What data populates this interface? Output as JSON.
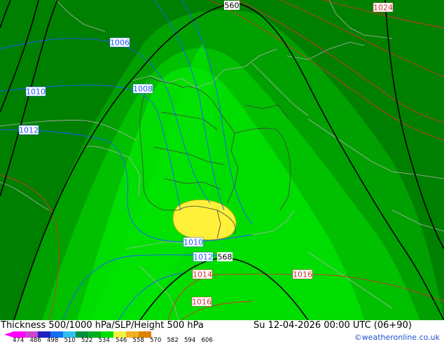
{
  "map": {
    "title": "Thickness 500/1000 hPa/SLP/Height 500 hPa",
    "datetime": "Su 12-04-2026 00:00 UTC (06+90)",
    "credit": "©weatheronline.co.uk",
    "colors": {
      "bg_dark": "#008000",
      "band1": "#00a000",
      "band2": "#00c000",
      "band3": "#00dd00",
      "warm": "#fff03a",
      "slp_blue": "#1e5aff",
      "slp_red": "#d23232",
      "height": "#000000",
      "border": "#b0b0b0"
    },
    "labels": {
      "slp_1006": "1006",
      "slp_1008": "1008",
      "slp_1010_w": "1010",
      "slp_1012_w": "1012",
      "slp_1010_s": "1010",
      "slp_1012_s": "1012",
      "slp_1014": "1014",
      "slp_1016_e": "1016",
      "slp_1016_s": "1016",
      "slp_1024": "1024",
      "h_560": "560",
      "h_568": "568"
    }
  },
  "legend": {
    "values": [
      "474",
      "486",
      "498",
      "510",
      "522",
      "534",
      "546",
      "558",
      "570",
      "582",
      "594",
      "606"
    ],
    "colors": [
      "#ff00ff",
      "#cc44cc",
      "#2020c0",
      "#1070f0",
      "#30c0f0",
      "#009040",
      "#00b020",
      "#00e000",
      "#f0f040",
      "#f0b020",
      "#e08000",
      "#ffffff"
    ]
  }
}
